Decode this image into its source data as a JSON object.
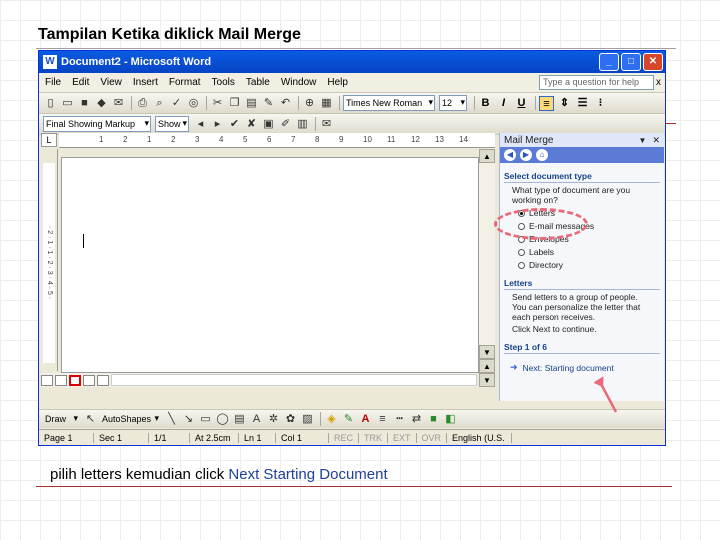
{
  "slide": {
    "title": "Tampilan Ketika diklick Mail Merge",
    "caption_prefix": "pilih letters  kemudian click ",
    "caption_highlight": "Next Starting Document"
  },
  "window": {
    "title": "Document2 - Microsoft Word",
    "app_letter": "W",
    "controls": {
      "minimize": "_",
      "maximize": "□",
      "close": "✕"
    }
  },
  "menu": {
    "items": [
      "File",
      "Edit",
      "View",
      "Insert",
      "Format",
      "Tools",
      "Table",
      "Window",
      "Help"
    ],
    "ask_placeholder": "Type a question for help",
    "ask_close": "x"
  },
  "format_toolbar": {
    "font": "Times New Roman",
    "size": "12",
    "bold": "B",
    "italic": "I",
    "underline": "U"
  },
  "reviewing_toolbar": {
    "display": "Final Showing Markup",
    "show": "Show"
  },
  "ruler": {
    "tab_marker": "L",
    "labels": [
      "1",
      "2",
      "1",
      "2",
      "3",
      "4",
      "5",
      "6",
      "7",
      "8",
      "9",
      "10",
      "11",
      "12",
      "13",
      "14"
    ],
    "vertical": "· 2 · 1 · 1 · 2 · 3 · 4 · 5 ·"
  },
  "task_pane": {
    "title": "Mail Merge",
    "section1": "Select document type",
    "question": "What type of document are you working on?",
    "options": [
      "Letters",
      "E-mail messages",
      "Envelopes",
      "Labels",
      "Directory"
    ],
    "selected": "Letters",
    "section2": "Letters",
    "description": "Send letters to a group of people. You can personalize the letter that each person receives.",
    "continue_text": "Click Next to continue.",
    "step": "Step 1 of 6",
    "next_link": "Next: Starting document"
  },
  "drawing_toolbar": {
    "draw": "Draw",
    "autoshapes": "AutoShapes"
  },
  "status": {
    "page": "Page 1",
    "sec": "Sec 1",
    "pages": "1/1",
    "at": "At 2.5cm",
    "ln": "Ln 1",
    "col": "Col 1",
    "rec": "REC",
    "trk": "TRK",
    "ext": "EXT",
    "ovr": "OVR",
    "lang": "English (U.S."
  },
  "colors": {
    "titlebar": "#0a5be3",
    "highlight_ring": "#e86a78",
    "annotation_arrow": "#e86a78",
    "link": "#15428b"
  }
}
